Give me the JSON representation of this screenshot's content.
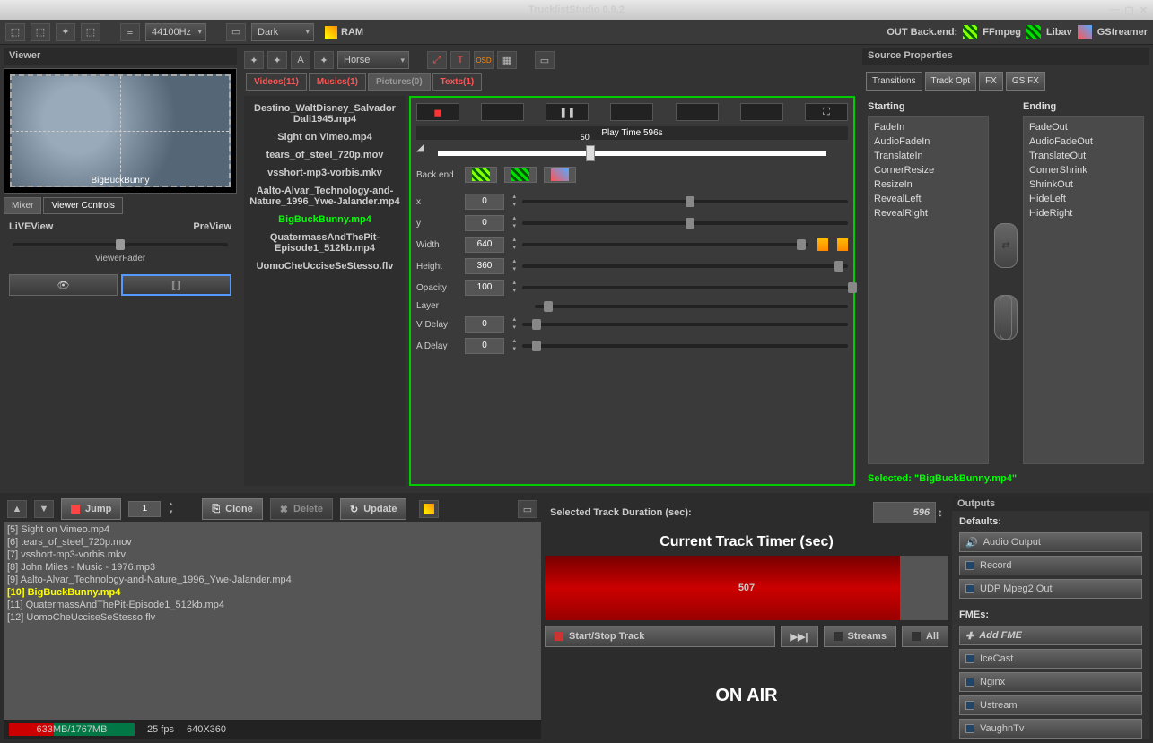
{
  "window": {
    "title": "TrucklistStudio 0.9.2"
  },
  "toolbar": {
    "sample_rate": "44100Hz",
    "theme": "Dark",
    "ram_label": "RAM",
    "backend_label": "OUT Back.end:",
    "backends": [
      "FFmpeg",
      "Libav",
      "GStreamer"
    ]
  },
  "viewer": {
    "title": "Viewer",
    "preview_caption": "BigBuckBunny",
    "tabs": [
      "Mixer",
      "Viewer Controls"
    ],
    "live": "LiVEView",
    "pre": "PreView",
    "fader_label": "ViewerFader"
  },
  "center": {
    "combo": "Horse",
    "tabs": [
      "Videos(11)",
      "Musics(1)",
      "Pictures(0)",
      "Texts(1)"
    ],
    "files": [
      "Destino_WaltDisney_Salvador Dali1945.mp4",
      "Sight on Vimeo.mp4",
      "tears_of_steel_720p.mov",
      "vsshort-mp3-vorbis.mkv",
      "Aalto-Alvar_Technology-and-Nature_1996_Ywe-Jalander.mp4",
      "BigBuckBunny.mp4",
      "QuatermassAndThePit-Episode1_512kb.mp4",
      "UomoCheUcciseSeStesso.flv"
    ],
    "selected_index": 5
  },
  "props": {
    "play_time": "Play Time 596s",
    "time_mark": "50",
    "backend_label": "Back.end",
    "rows": {
      "x": {
        "label": "x",
        "val": "0",
        "pos": 50
      },
      "y": {
        "label": "y",
        "val": "0",
        "pos": 50
      },
      "w": {
        "label": "Width",
        "val": "640",
        "pos": 96
      },
      "h": {
        "label": "Height",
        "val": "360",
        "pos": 96
      },
      "o": {
        "label": "Opacity",
        "val": "100",
        "pos": 100
      },
      "l": {
        "label": "Layer",
        "val": "",
        "pos": 3
      },
      "vd": {
        "label": "V Delay",
        "val": "0",
        "pos": 3
      },
      "ad": {
        "label": "A Delay",
        "val": "0",
        "pos": 3
      }
    }
  },
  "source_props": {
    "title": "Source Properties",
    "tabs": [
      "Transitions",
      "Track Opt",
      "FX",
      "GS FX"
    ],
    "starting_title": "Starting",
    "ending_title": "Ending",
    "starting": [
      "FadeIn",
      "AudioFadeIn",
      "TranslateIn",
      "CornerResize",
      "ResizeIn",
      "RevealLeft",
      "RevealRight"
    ],
    "ending": [
      "FadeOut",
      "AudioFadeOut",
      "TranslateOut",
      "CornerShrink",
      "ShrinkOut",
      "HideLeft",
      "HideRight"
    ],
    "selected_label": "Selected:",
    "selected_value": "\"BigBuckBunny.mp4\""
  },
  "tracklist": {
    "jump": "Jump",
    "jump_val": "1",
    "clone": "Clone",
    "delete": "Delete",
    "update": "Update",
    "items": [
      "[5] Sight on Vimeo.mp4",
      "[6] tears_of_steel_720p.mov",
      "[7] vsshort-mp3-vorbis.mkv",
      "[8] John Miles - Music - 1976.mp3",
      "[9] Aalto-Alvar_Technology-and-Nature_1996_Ywe-Jalander.mp4",
      "[10] BigBuckBunny.mp4",
      "[11] QuatermassAndThePit-Episode1_512kb.mp4",
      "[12] UomoCheUcciseSeStesso.flv"
    ],
    "current_index": 5
  },
  "timer": {
    "duration_label": "Selected Track Duration (sec):",
    "duration_val": "596",
    "timer_label": "Current Track Timer (sec)",
    "timer_val": "507",
    "start_stop": "Start/Stop Track",
    "next": "▶▶|",
    "streams": "Streams",
    "all": "All",
    "onair": "ON AIR"
  },
  "outputs": {
    "title": "Outputs",
    "defaults": "Defaults:",
    "audio": "Audio Output",
    "record": "Record",
    "udp": "UDP Mpeg2 Out",
    "fmes": "FMEs:",
    "add": "Add FME",
    "list": [
      "IceCast",
      "Nginx",
      "Ustream",
      "VaughnTv"
    ]
  },
  "status": {
    "mem": "633MB/1767MB",
    "fps": "25 fps",
    "res": "640X360"
  }
}
